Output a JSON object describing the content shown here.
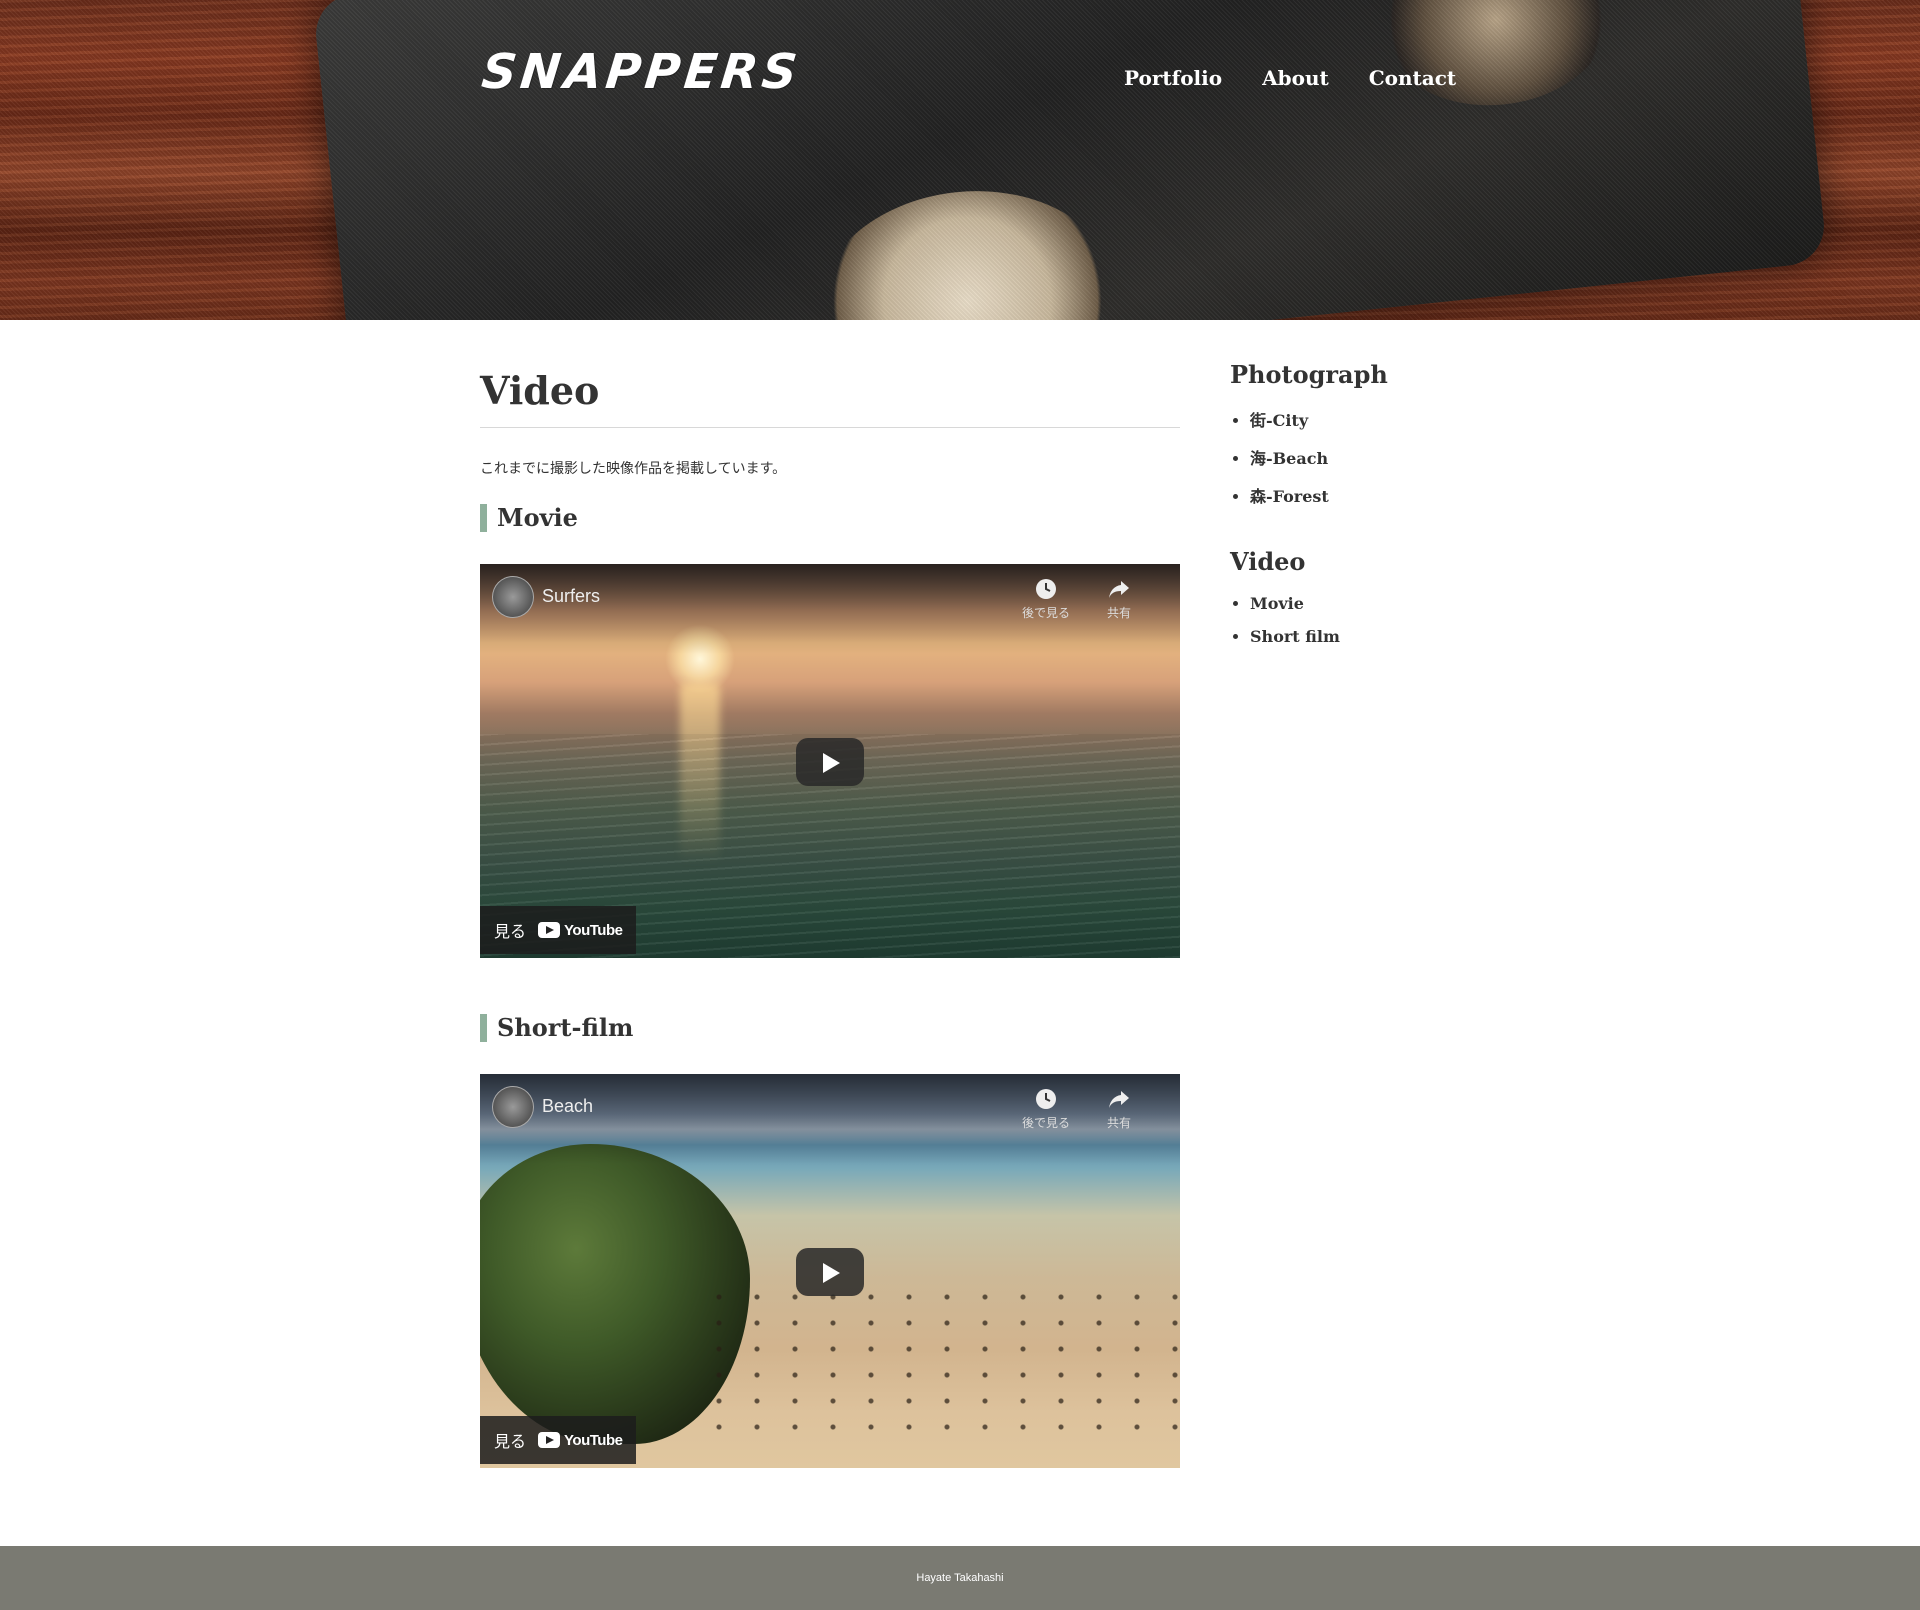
{
  "header": {
    "logo": "SNAPPERS",
    "nav": [
      "Portfolio",
      "About",
      "Contact"
    ]
  },
  "main": {
    "title": "Video",
    "lead": "これまでに撮影した映像作品を掲載しています。",
    "sections": [
      {
        "heading": "Movie",
        "video": {
          "title": "Surfers",
          "watch_later": "後で見る",
          "share": "共有",
          "watch_on": "見る",
          "youtube": "YouTube"
        }
      },
      {
        "heading": "Short-film",
        "video": {
          "title": "Beach",
          "watch_later": "後で見る",
          "share": "共有",
          "watch_on": "見る",
          "youtube": "YouTube"
        }
      }
    ]
  },
  "sidebar": {
    "groups": [
      {
        "heading": "Photograph",
        "items": [
          "街-City",
          "海-Beach",
          "森-Forest"
        ]
      },
      {
        "heading": "Video",
        "items": [
          "Movie",
          "Short film"
        ]
      }
    ]
  },
  "footer": {
    "text": "Hayate Takahashi"
  },
  "colors": {
    "accent_bar": "#8fb09c",
    "footer_bg": "#7a7a72",
    "text": "#333333"
  },
  "icons": {
    "watch_later": "clock-icon",
    "share": "share-arrow-icon",
    "play": "play-icon",
    "youtube": "youtube-logo-icon"
  }
}
